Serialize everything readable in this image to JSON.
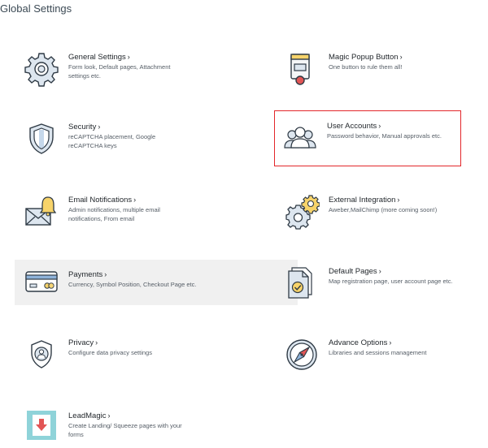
{
  "page_title": "Global Settings",
  "items": [
    {
      "title": "General Settings",
      "desc": "Form look, Default pages, Attachment settings etc."
    },
    {
      "title": "Magic Popup Button",
      "desc": "One button to rule them all!"
    },
    {
      "title": "Security",
      "desc": "reCAPTCHA placement, Google reCAPTCHA keys"
    },
    {
      "title": "User Accounts",
      "desc": "Password behavior, Manual approvals etc."
    },
    {
      "title": "Email Notifications",
      "desc": "Admin notifications, multiple email notifications, From email"
    },
    {
      "title": "External Integration",
      "desc": "Aweber,MailChimp (more coming soon!)"
    },
    {
      "title": "Payments",
      "desc": "Currency, Symbol Position, Checkout Page etc."
    },
    {
      "title": "Default Pages",
      "desc": "Map registration page, user account page etc."
    },
    {
      "title": "Privacy",
      "desc": "Configure data privacy settings"
    },
    {
      "title": "Advance Options",
      "desc": "Libraries and sessions management"
    },
    {
      "title": "LeadMagic",
      "desc": "Create Landing/ Squeeze pages with your forms"
    }
  ],
  "chevron": "›",
  "colors": {
    "selected_border": "#e3262a",
    "hover_bg": "#f0f0f0"
  }
}
